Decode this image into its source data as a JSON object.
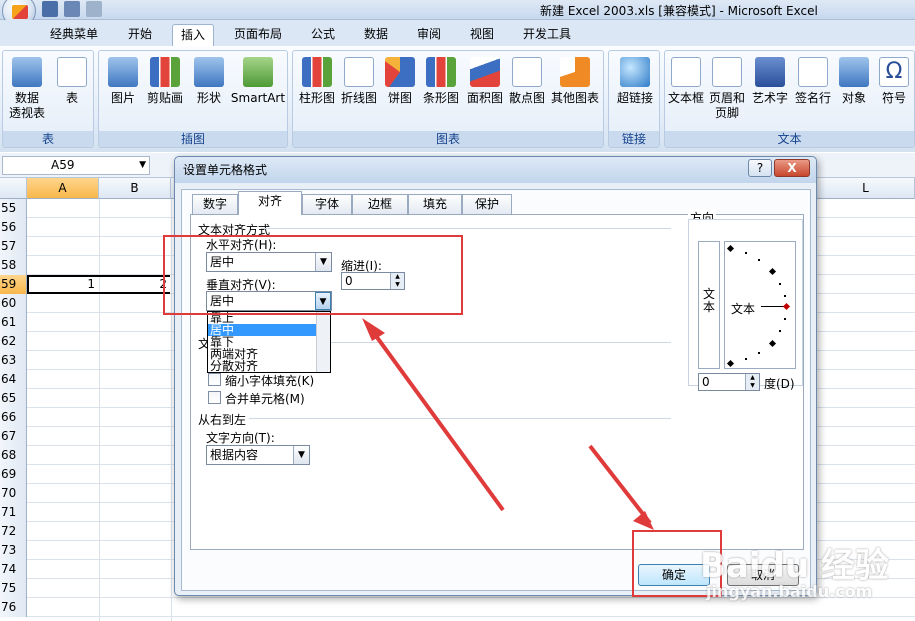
{
  "window": {
    "title": "新建 Excel 2003.xls  [兼容模式] - Microsoft Excel"
  },
  "ribbon_tabs": [
    "经典菜单",
    "开始",
    "插入",
    "页面布局",
    "公式",
    "数据",
    "审阅",
    "视图",
    "开发工具"
  ],
  "active_ribbon_tab": "插入",
  "ribbon_groups": {
    "table": {
      "name": "表",
      "buttons": [
        "数据\n透视表",
        "表"
      ]
    },
    "illustration": {
      "name": "插图",
      "buttons": [
        "图片",
        "剪贴画",
        "形状",
        "SmartArt"
      ]
    },
    "charts": {
      "name": "图表",
      "buttons": [
        "柱形图",
        "折线图",
        "饼图",
        "条形图",
        "面积图",
        "散点图",
        "其他图表"
      ]
    },
    "links": {
      "name": "链接",
      "buttons": [
        "超链接"
      ]
    },
    "text": {
      "name": "文本",
      "buttons": [
        "文本框",
        "页眉和\n页脚",
        "艺术字",
        "签名行",
        "对象",
        "符号"
      ]
    }
  },
  "namebox": {
    "value": "A59"
  },
  "columns": [
    "A",
    "B",
    "L"
  ],
  "rows": [
    "55",
    "56",
    "57",
    "58",
    "59",
    "60",
    "61",
    "62",
    "63",
    "64",
    "65",
    "66",
    "67",
    "68",
    "69",
    "70",
    "71",
    "72",
    "73",
    "74",
    "75",
    "76"
  ],
  "cells": {
    "A59": "1",
    "B59": "2"
  },
  "dialog": {
    "title": "设置单元格格式",
    "help": "?",
    "close": "X",
    "tabs": [
      "数字",
      "对齐",
      "字体",
      "边框",
      "填充",
      "保护"
    ],
    "active_tab": "对齐",
    "text_align_section": "文本对齐方式",
    "horizontal_label": "水平对齐(H):",
    "horizontal_value": "居中",
    "indent_label": "缩进(I):",
    "indent_value": "0",
    "vertical_label": "垂直对齐(V):",
    "vertical_value": "居中",
    "vertical_options": [
      "靠上",
      "居中",
      "靠下",
      "两端对齐",
      "分散对齐"
    ],
    "vertical_highlighted": "居中",
    "text_control_section": "文",
    "shrink_label": "缩小字体填充(K)",
    "merge_label": "合并单元格(M)",
    "rtl_section": "从右到左",
    "direction_label": "文字方向(T):",
    "direction_value": "根据内容",
    "orientation_label": "方向",
    "orientation_vertical_text": "文\n本",
    "orientation_text": "文本",
    "degree_value": "0",
    "degree_label": "度(D)",
    "ok": "确定",
    "cancel": "取消"
  },
  "watermark": {
    "brand": "Baidu 经验",
    "url": "jingyan.baidu.com"
  },
  "colors": {
    "annotation_red": "#e03b3b",
    "selection_orange": "#f8b74b",
    "list_highlight": "#3399ff"
  }
}
